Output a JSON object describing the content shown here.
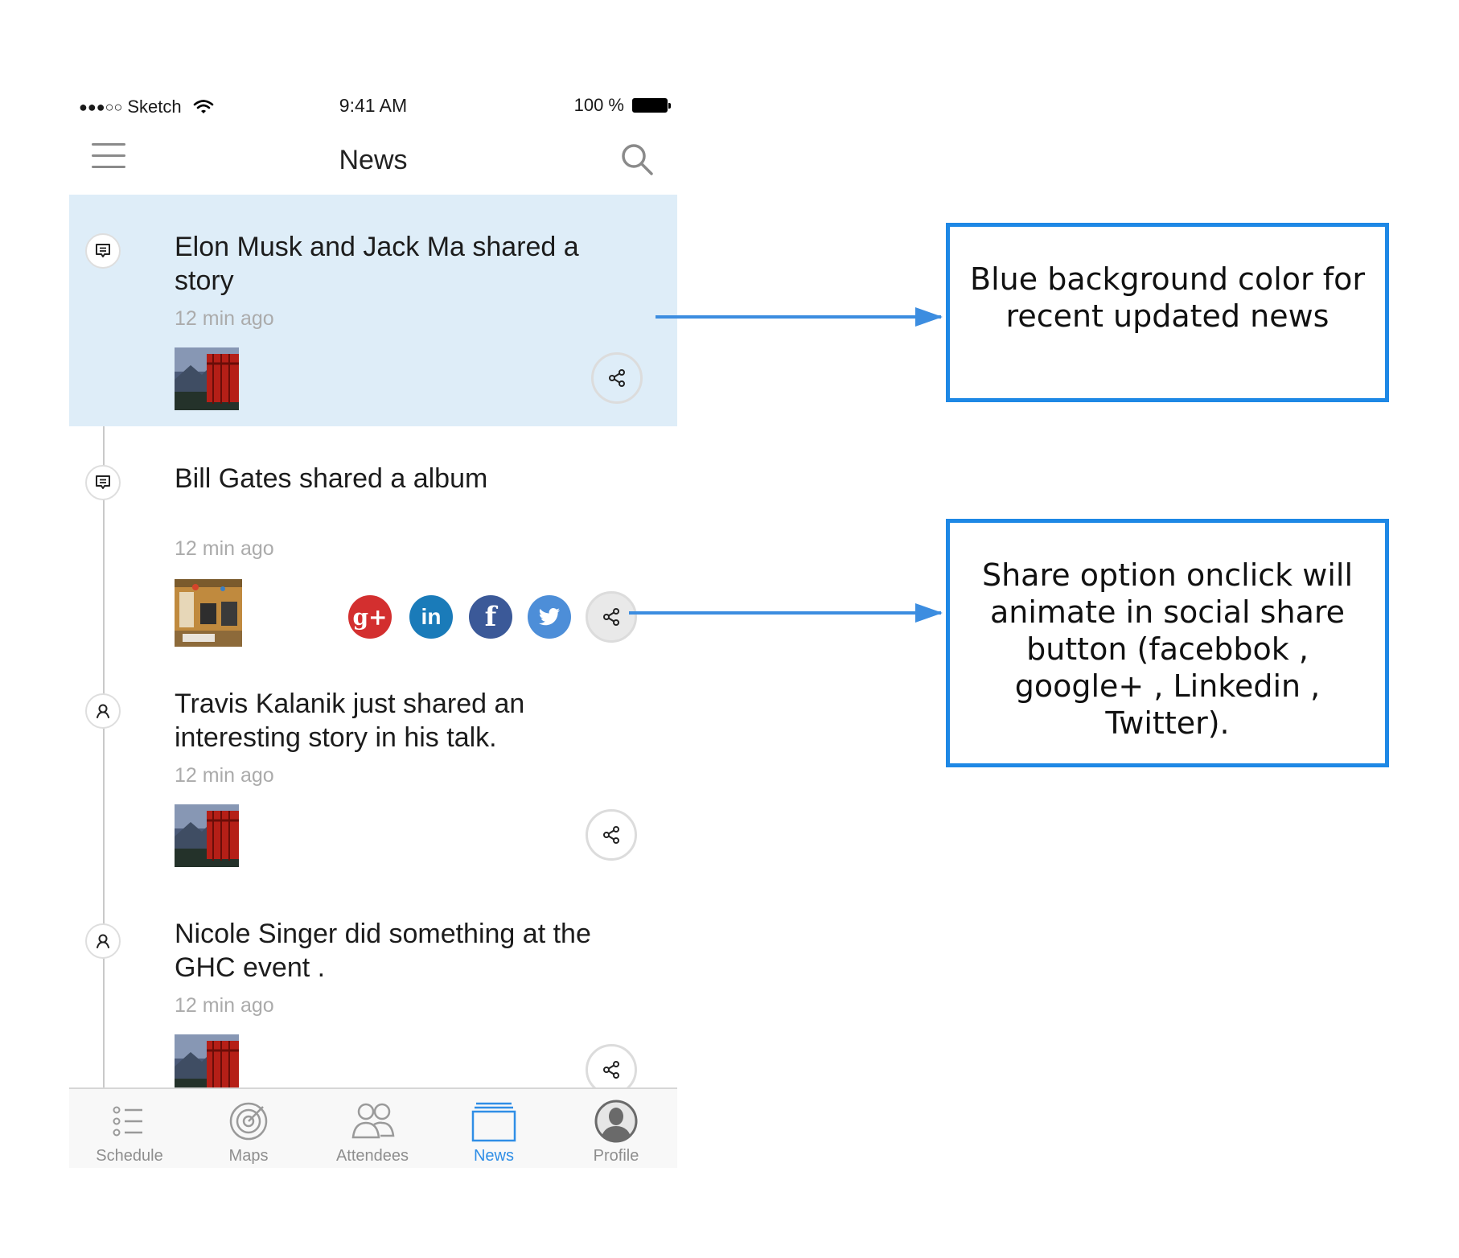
{
  "status_bar": {
    "carrier": "Sketch",
    "signal": "●●●○○",
    "time": "9:41 AM",
    "battery": "100 %"
  },
  "nav": {
    "title": "News",
    "menu_icon": "hamburger-menu-icon",
    "search_icon": "search-icon"
  },
  "news": [
    {
      "title": "Elon Musk and Jack Ma shared a story",
      "time": "12 min ago",
      "type": "message",
      "highlight": true,
      "thumb": "bridge-photo"
    },
    {
      "title": "Bill Gates shared a album",
      "time": "12 min ago",
      "type": "message",
      "highlight": false,
      "thumb": "desk-photo",
      "share_open": true
    },
    {
      "title": "Travis Kalanik just shared an interesting story in his talk.",
      "time": "12 min ago",
      "type": "person",
      "highlight": false,
      "thumb": "bridge-photo"
    },
    {
      "title": "Nicole Singer did something at the GHC event .",
      "time": "12 min ago",
      "type": "person",
      "highlight": false,
      "thumb": "bridge-photo"
    }
  ],
  "social": [
    {
      "name": "google-plus",
      "glyph": "g+",
      "color": "#d32f2f"
    },
    {
      "name": "linkedin",
      "glyph": "in",
      "color": "#1a7bb9"
    },
    {
      "name": "facebook",
      "glyph": "f",
      "color": "#3b5998"
    },
    {
      "name": "twitter",
      "glyph": "twitter-bird",
      "color": "#4d8ed8"
    }
  ],
  "tabs": [
    {
      "label": "Schedule",
      "icon": "schedule-list-icon",
      "active": false
    },
    {
      "label": "Maps",
      "icon": "maps-target-icon",
      "active": false
    },
    {
      "label": "Attendees",
      "icon": "attendees-icon",
      "active": false
    },
    {
      "label": "News",
      "icon": "news-icon",
      "active": true
    },
    {
      "label": "Profile",
      "icon": "profile-icon",
      "active": false
    }
  ],
  "annotations": [
    {
      "text": "Blue background color for recent updated news"
    },
    {
      "text": "Share option onclick will animate in social share button (facebbok , google+ , Linkedin , Twitter)."
    }
  ],
  "colors": {
    "highlight_bg": "#deedf8",
    "accent": "#2f8ee6",
    "annotation_border": "#1e88e5",
    "arrow": "#3c8de0"
  }
}
